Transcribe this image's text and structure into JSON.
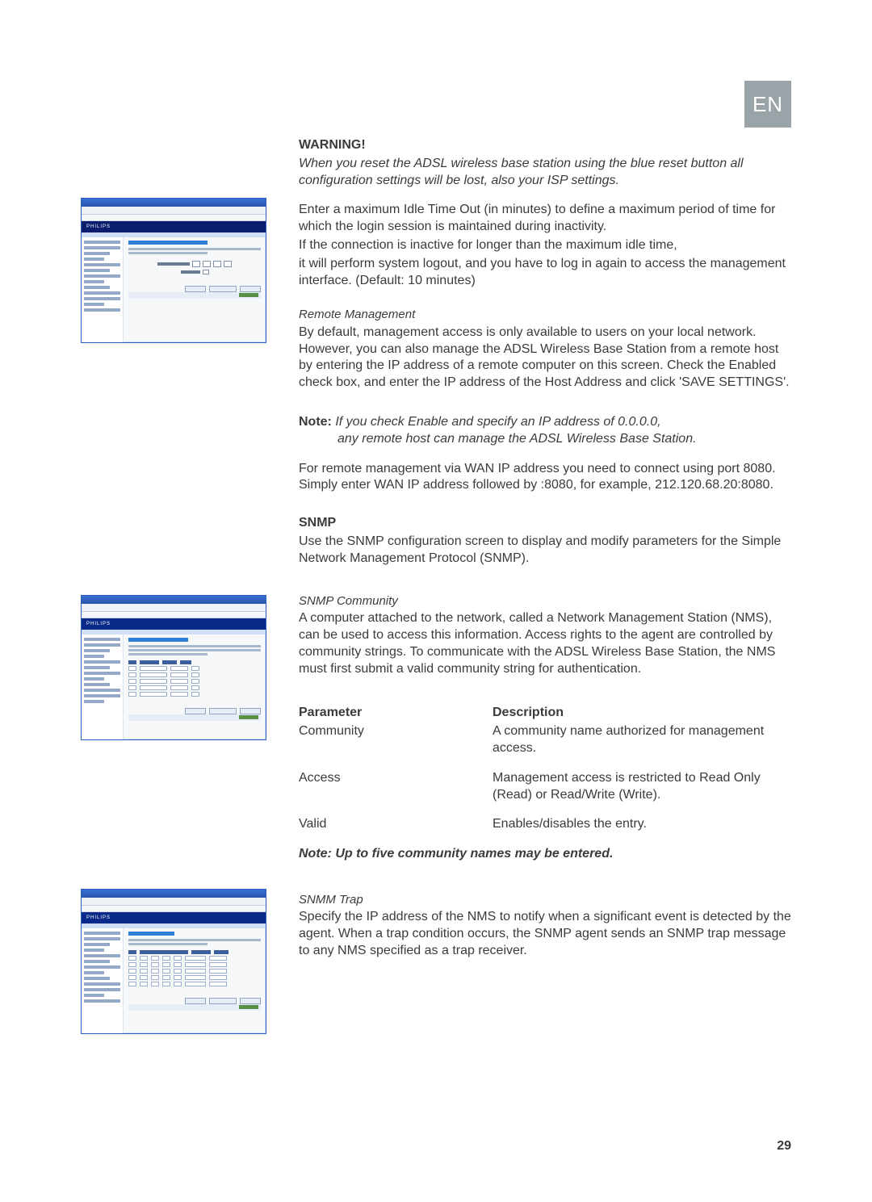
{
  "lang_badge": "EN",
  "page_number": "29",
  "sections": {
    "warning": {
      "heading": "WARNING!",
      "body_italic": "When you reset the ADSL wireless base station using the blue reset button all configuration settings will be lost, also your ISP settings."
    },
    "idle": {
      "p1": "Enter a maximum Idle Time Out (in minutes) to define a maximum period of time for which the login session is maintained during inactivity.",
      "p2": "If the connection is inactive for longer than the maximum idle time,",
      "p3": "it will perform system logout, and you have to log in again to access the management interface. (Default: 10 minutes)"
    },
    "remote": {
      "heading": "Remote Management",
      "body": "By default, management access is only available to users on your local network. However, you can also manage the ADSL Wireless Base Station from a remote host by entering the IP address of a remote computer on this screen. Check the Enabled check box, and enter the IP address of the Host Address and click 'SAVE SETTINGS'.",
      "note_label": "Note:",
      "note_line1": "If you check Enable and specify an IP address of 0.0.0.0,",
      "note_line2": "any remote host can manage the ADSL Wireless Base Station.",
      "p_after": "For remote management via WAN IP address you need to connect using port 8080. Simply enter WAN IP address followed by :8080, for example, 212.120.68.20:8080."
    },
    "snmp": {
      "heading": "SNMP",
      "intro": "Use the SNMP configuration screen to display and modify parameters for the Simple Network Management Protocol (SNMP)."
    },
    "community": {
      "heading": "SNMP Community",
      "body": "A computer attached to the network, called a Network Management Station (NMS), can be used to access this information. Access rights to the agent are controlled by community strings. To communicate with the ADSL Wireless Base Station, the NMS must first submit a valid community string for authentication.",
      "table": {
        "header_param": "Parameter",
        "header_desc": "Description",
        "rows": [
          {
            "param": "Community",
            "desc": "A community name authorized for management access."
          },
          {
            "param": "Access",
            "desc": "Management access is restricted to Read Only (Read) or Read/Write (Write)."
          },
          {
            "param": "Valid",
            "desc": "Enables/disables the entry."
          }
        ]
      },
      "note_italic": "Note: Up to five community names may be entered."
    },
    "trap": {
      "heading": "SNMM Trap",
      "body": "Specify the IP address of the NMS to notify when a significant event is detected by the agent. When a trap condition occurs, the SNMP agent sends an SNMP trap message to any NMS specified as a trap receiver."
    }
  },
  "mock": {
    "brand": "PHILIPS"
  }
}
